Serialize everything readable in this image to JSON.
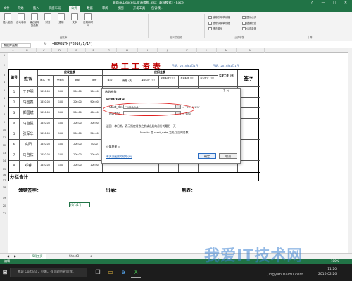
{
  "window": {
    "title": "最新员工excel工资表模板.xlsx [兼容模式] - Excel",
    "controls": [
      "?",
      "—",
      "□",
      "✕"
    ]
  },
  "ribbon": {
    "tabs": [
      "文件",
      "开始",
      "插入",
      "页面布局",
      "公式",
      "数据",
      "审阅",
      "视图",
      "开发工具",
      "告诉我..."
    ],
    "active_tab": "公式",
    "buttons": [
      "插入函数",
      "自动求和",
      "最近使用的函数",
      "财务",
      "逻辑",
      "文本",
      "日期和时间"
    ],
    "small_buttons": [
      "追踪引用单元格",
      "追踪从属单元格",
      "移去箭头",
      "显示公式",
      "错误检查",
      "公式求值"
    ],
    "groups": [
      "函数库",
      "定义的名称",
      "公式审核",
      "计算"
    ]
  },
  "formula_bar": {
    "name_box": "数据库函数",
    "fx": "fx",
    "formula": "=EOMONTH(\"2016/1/1\")"
  },
  "columns": [
    "A",
    "B",
    "C",
    "D",
    "E",
    "F",
    "G",
    "H",
    "I",
    "J",
    "K",
    "L",
    "M",
    "N"
  ],
  "rows": [
    "1",
    "2",
    "3",
    "4",
    "5",
    "6",
    "7",
    "8",
    "9",
    "10",
    "11",
    "12",
    "13",
    "14",
    "15",
    "16",
    "17",
    "18",
    "19",
    "20",
    "21"
  ],
  "sheet": {
    "title": "员工工资表",
    "date_label_left": "日期：2015年1月1日",
    "date_label_right": "日期：2015年1月1日",
    "headers": {
      "id": "编号",
      "name": "姓名",
      "should_pay": "应发金额",
      "deductions": "应扣金额",
      "base_salary": "基本工资",
      "perf_salary": "全勤奖",
      "subsidy": "补助",
      "overtime": "加班",
      "bonus": "奖金",
      "sick_leave": "病假（天）",
      "personal_leave": "事假扣款（元）",
      "late": "迟到扣款（元）",
      "leave": "早退扣款（元）",
      "total": "应扣合计（元）",
      "actual_pay": "实发工资（元）",
      "signature": "签字"
    },
    "employees": [
      {
        "id": "1",
        "name": "王卫明",
        "v": [
          "1450.00",
          "100",
          "200.00",
          "100.00"
        ]
      },
      {
        "id": "2",
        "name": "马国鑫",
        "v": [
          "1450.00",
          "100",
          "200.00",
          "900.00"
        ]
      },
      {
        "id": "3",
        "name": "郑国斌",
        "v": [
          "1450.00",
          "100",
          "200.00",
          "460.00"
        ]
      },
      {
        "id": "4",
        "name": "马自强",
        "v": [
          "1450.00",
          "100",
          "200.00",
          "300.00"
        ]
      },
      {
        "id": "5",
        "name": "张军华",
        "v": [
          "1450.00",
          "100",
          "200.00",
          "340.00"
        ]
      },
      {
        "id": "6",
        "name": "高阳",
        "v": [
          "1450.00",
          "100",
          "200.00",
          "80.00"
        ]
      },
      {
        "id": "7",
        "name": "马自佑",
        "v": [
          "1450.00",
          "100",
          "200.00",
          "200.00"
        ]
      },
      {
        "id": "8",
        "name": "邓睿",
        "v": [
          "1450.00",
          "100",
          "200.00",
          "100.00"
        ]
      }
    ],
    "total_row": "分栏合计",
    "footer": {
      "leader_sign": "领导签字：",
      "cashier": "出纳：",
      "preparer": "制表："
    },
    "selected_cell": "(6/1/1\")"
  },
  "dialog": {
    "title": "函数参数",
    "function_name": "EOMONTH",
    "args": [
      {
        "label": "Start_date",
        "value": "\"2016/1/1\"",
        "result": "= \"2016/1/1\""
      },
      {
        "label": "Months",
        "value": "",
        "result": "= 数值"
      }
    ],
    "description": "返回一串日期，表示指定月数之前或之后的月份的最后一天",
    "arg_description": "Months  是 start_date 之前/之后的月数",
    "result_label": "计算结果 =",
    "help_link": "有关该函数的帮助(H)",
    "ok": "确定",
    "cancel": "取消",
    "close": "?  ✕"
  },
  "sheet_tabs": [
    "5月工资",
    "Sheet3"
  ],
  "status_bar": {
    "mode": "编辑",
    "zoom": "100%"
  },
  "taskbar": {
    "search_placeholder": "我是 Cortana，小娜。有问题尽管问我。",
    "time": "11:20",
    "date": "2016-02-26"
  },
  "watermark": {
    "main": "我爱IT技术网",
    "sub": "jingyan.baidu.com"
  },
  "colors": {
    "excel_green": "#217346",
    "title_red": "#c00000",
    "highlight_red": "#e02020"
  }
}
